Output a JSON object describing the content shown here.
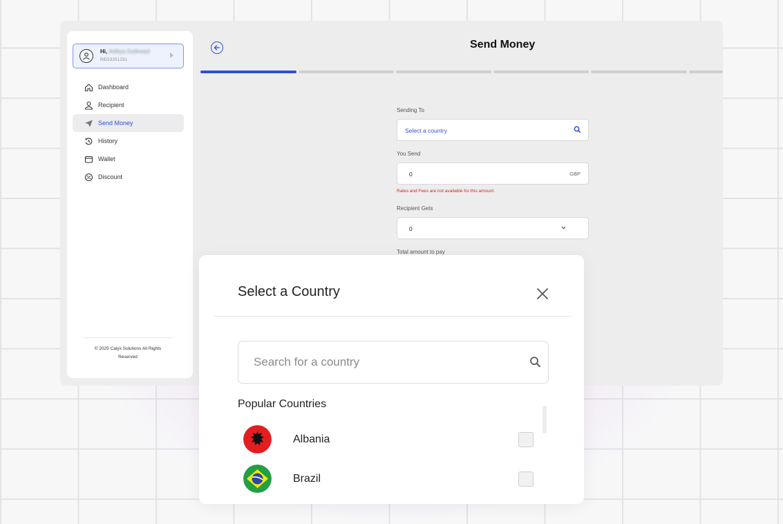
{
  "user": {
    "greeting": "Hi,",
    "name": "Aditya Gaikwad",
    "id": "REG3251231"
  },
  "nav": [
    {
      "label": "Dashboard",
      "icon": "home-icon"
    },
    {
      "label": "Recipient",
      "icon": "user-icon"
    },
    {
      "label": "Send Money",
      "icon": "send-icon",
      "active": true
    },
    {
      "label": "History",
      "icon": "history-icon"
    },
    {
      "label": "Wallet",
      "icon": "wallet-icon"
    },
    {
      "label": "Discount",
      "icon": "discount-icon"
    }
  ],
  "footer": {
    "line1": "© 2025 Calyx Solutions All Rights",
    "line2": "Reserved"
  },
  "page": {
    "title": "Send Money",
    "progress_steps": 6,
    "current_step": 1
  },
  "form": {
    "sending_to_label": "Sending To",
    "sending_to_placeholder": "Select a country",
    "you_send_label": "You Send",
    "you_send_value": "0",
    "you_send_currency": "GBP",
    "error": "Rates and Fees are not available for this amount.",
    "recipient_gets_label": "Recipient Gets",
    "recipient_gets_value": "0",
    "total_label": "Total amount to pay"
  },
  "modal": {
    "title": "Select a Country",
    "search_placeholder": "Search for a country",
    "section_label": "Popular Countries",
    "countries": [
      {
        "name": "Albania",
        "flag_color": "#e41e20"
      },
      {
        "name": "Brazil",
        "flag_color": "#229e45"
      }
    ]
  },
  "colors": {
    "accent": "#2f4fd6",
    "error": "#dd2222"
  }
}
